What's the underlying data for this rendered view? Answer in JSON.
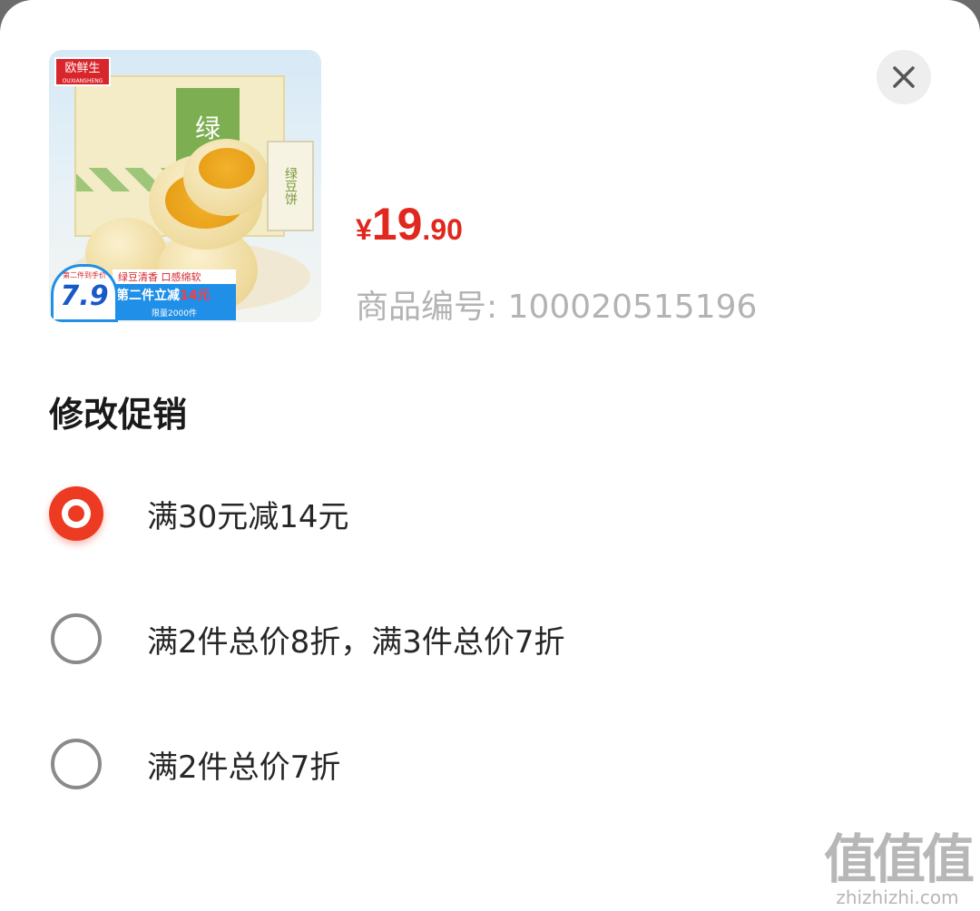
{
  "product": {
    "image": {
      "logo_text": "欧鲜生",
      "logo_subtext": "OUXIANSHENG",
      "box_label": "绿",
      "pack_text": "绿豆饼",
      "banner_top": "绿豆清香 口感绵软",
      "banner_main": "第二件立减",
      "banner_highlight": "14元",
      "banner_sub": "限量2000件",
      "badge_top": "第二件到手价",
      "badge_price": "7.9"
    },
    "price": {
      "currency": "¥",
      "integer": "19",
      "decimal": ".90"
    },
    "sku_label": "商品编号: 100020515196"
  },
  "close_icon": "close-icon",
  "section_title": "修改促销",
  "promotions": [
    {
      "label": "满30元减14元",
      "selected": true
    },
    {
      "label": "满2件总价8折，满3件总价7折",
      "selected": false
    },
    {
      "label": "满2件总价7折",
      "selected": false
    }
  ],
  "watermark": {
    "glyphs": "值值值",
    "url": "zhizhizhi.com"
  },
  "colors": {
    "accent": "#e0281e",
    "radio_selected": "#ec3b22",
    "radio_unselected": "#8a8a8a",
    "sku_text": "#b3b3b3"
  }
}
